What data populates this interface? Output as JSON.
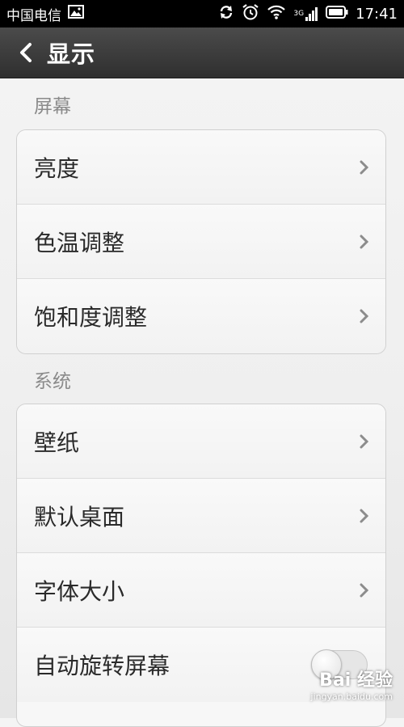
{
  "status_bar": {
    "carrier": "中国电信",
    "network_label": "3G",
    "time": "17:41"
  },
  "header": {
    "title": "显示"
  },
  "sections": [
    {
      "title": "屏幕",
      "items": [
        {
          "label": "亮度"
        },
        {
          "label": "色温调整"
        },
        {
          "label": "饱和度调整"
        }
      ]
    },
    {
      "title": "系统",
      "items": [
        {
          "label": "壁纸"
        },
        {
          "label": "默认桌面"
        },
        {
          "label": "字体大小"
        },
        {
          "label": "自动旋转屏幕",
          "toggle": false
        }
      ]
    }
  ],
  "watermark": {
    "logo": "Bai 经验",
    "url": "jingyan.baidu.com"
  },
  "colors": {
    "title_bar": "#3a3a3a",
    "status_bar": "#000000",
    "section_text": "#8a8a8a",
    "row_text": "#2a2a2a"
  }
}
